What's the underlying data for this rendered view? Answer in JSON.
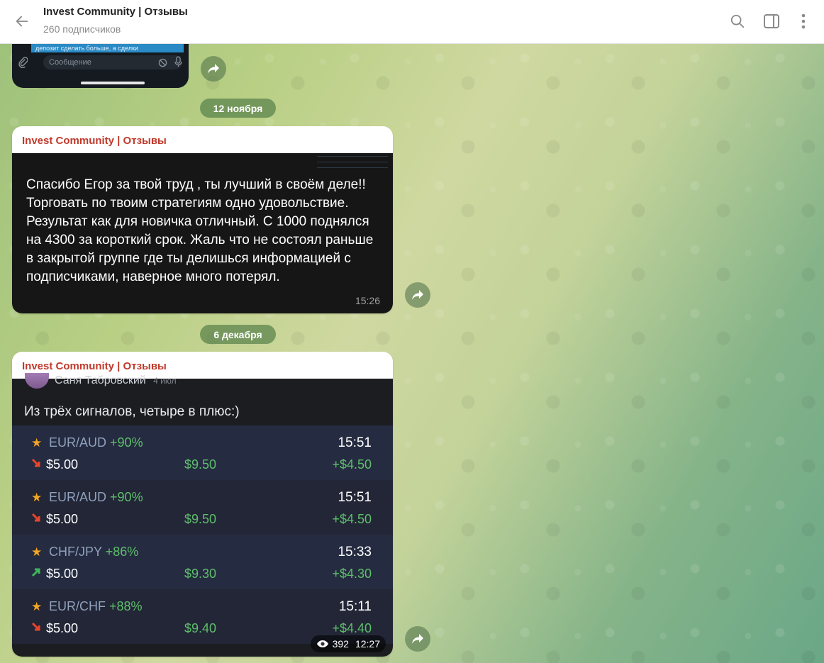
{
  "header": {
    "title": "Invest Community | Отзывы",
    "subscribers": "260 подписчиков"
  },
  "icons": {
    "back": "arrow-left-icon",
    "search": "search-icon",
    "sidebar": "sidebar-toggle-icon",
    "more": "more-vertical-icon",
    "share": "share-forward-icon",
    "views": "eye-icon"
  },
  "top_fragment": {
    "strip_text": "депозит сделать больше, а сделки",
    "input_placeholder": "Сообщение"
  },
  "dates": {
    "first": "12 ноября",
    "second": "6 декабря"
  },
  "messages": [
    {
      "sender": "Invest Community | Отзывы",
      "review_text": "Спасибо Егор за твой труд , ты лучший в своём деле!! Торговать по твоим стратегиям одно удовольствие. Результат как для новичка отличный. С 1000 поднялся на 4300 за короткий срок. Жаль что не состоял раньше в закрытой группе где ты делишься информацией с подписчиками, наверное много потерял.",
      "time": "15:26"
    },
    {
      "sender": "Invest Community | Отзывы",
      "author_name": "Саня Табровский",
      "author_date": "4 июл",
      "caption": "Из трёх сигналов, четыре в плюс:)",
      "signals": [
        {
          "pair": "EUR/AUD",
          "pct": "+90%",
          "time": "15:51",
          "direction": "down",
          "stake": "$5.00",
          "payout": "$9.50",
          "profit": "+$4.50"
        },
        {
          "pair": "EUR/AUD",
          "pct": "+90%",
          "time": "15:51",
          "direction": "down",
          "stake": "$5.00",
          "payout": "$9.50",
          "profit": "+$4.50"
        },
        {
          "pair": "CHF/JPY",
          "pct": "+86%",
          "time": "15:33",
          "direction": "up",
          "stake": "$5.00",
          "payout": "$9.30",
          "profit": "+$4.30"
        },
        {
          "pair": "EUR/CHF",
          "pct": "+88%",
          "time": "15:11",
          "direction": "down",
          "stake": "$5.00",
          "payout": "$9.40",
          "profit": "+$4.40"
        }
      ],
      "views": "392",
      "time": "12:27"
    }
  ],
  "colors": {
    "sender": "#c0392b",
    "profit_green": "#5fbf6c",
    "arrow_down": "#e8452c",
    "arrow_up": "#3fb55a",
    "star": "#f5a524"
  }
}
